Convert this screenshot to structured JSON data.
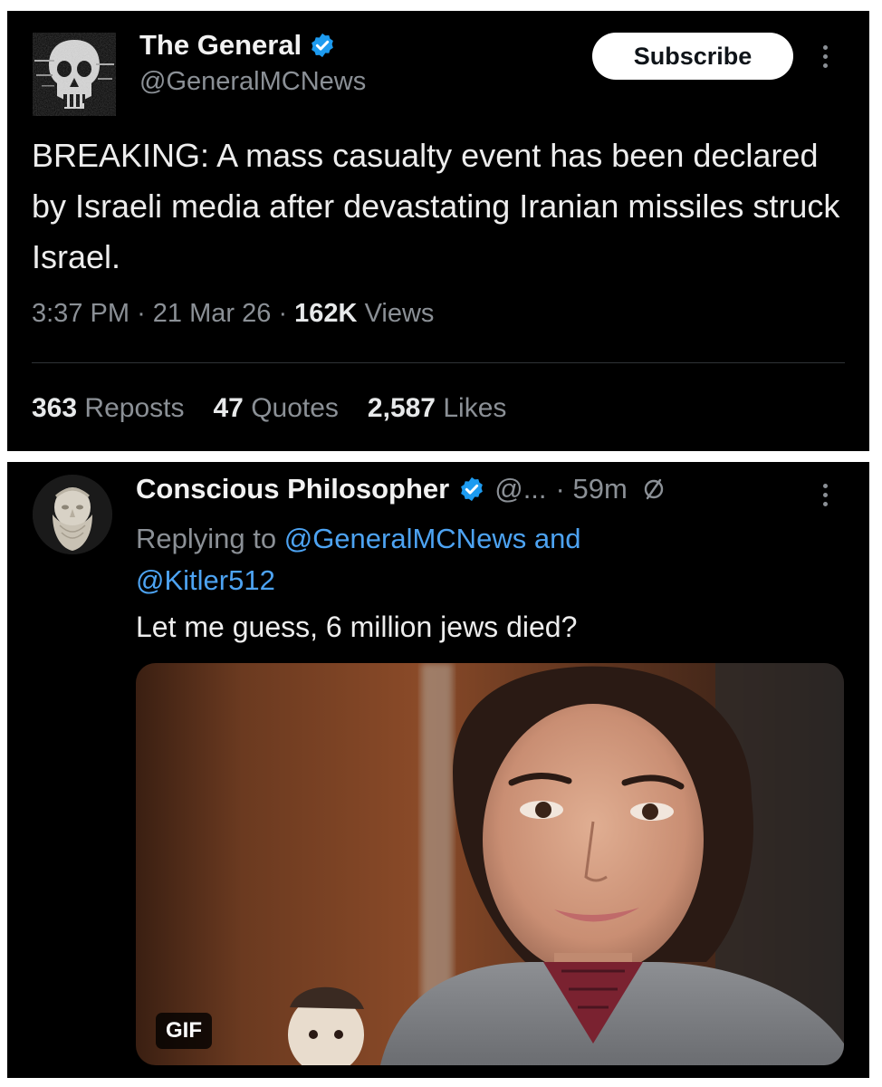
{
  "main_tweet": {
    "author_name": "The General",
    "author_handle": "@GeneralMCNews",
    "subscribe_label": "Subscribe",
    "body": "BREAKING: A mass casualty event has been declared by Israeli media after devastating Iranian missiles struck Israel.",
    "time": "3:37 PM",
    "date": "21 Mar 26",
    "views_count": "162K",
    "views_label": "Views",
    "separator": "·",
    "stats": [
      {
        "count": "363",
        "label": "Reposts"
      },
      {
        "count": "47",
        "label": "Quotes"
      },
      {
        "count": "2,587",
        "label": "Likes"
      }
    ]
  },
  "reply": {
    "author_name": "Conscious Philosopher",
    "author_handle": "@...",
    "time": "· 59m",
    "replying_prefix": "Replying to",
    "mention_1": "@GeneralMCNews",
    "connector": "and",
    "mention_2": "@Kitler512",
    "body": "Let me guess, 6 million jews died?",
    "media_badge": "GIF"
  },
  "icons": {
    "verified": "verified-badge-icon",
    "more": "more-vertical-icon",
    "mute": "mute-icon"
  },
  "colors": {
    "background": "#000000",
    "text_primary": "#e7e9ea",
    "text_secondary": "#8b9096",
    "link": "#4da3f2",
    "verified": "#1d9bf0"
  }
}
